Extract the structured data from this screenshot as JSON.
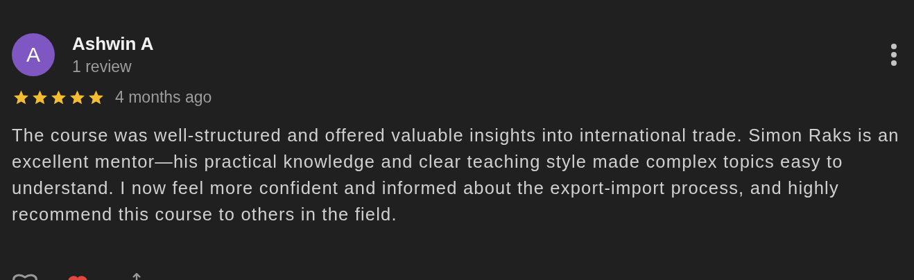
{
  "review": {
    "avatar": {
      "letter": "A",
      "color": "#7e57c2"
    },
    "author": "Ashwin A",
    "author_meta": "1 review",
    "stars": 5,
    "time": "4 months ago",
    "text": "The course was well-structured and offered valuable insights into international trade. Simon Raks is an excellent mentor—his practical knowledge and clear teaching style made complex topics easy to understand. I now feel more confident and informed about the export-import process, and highly recommend this course to others in the field."
  }
}
